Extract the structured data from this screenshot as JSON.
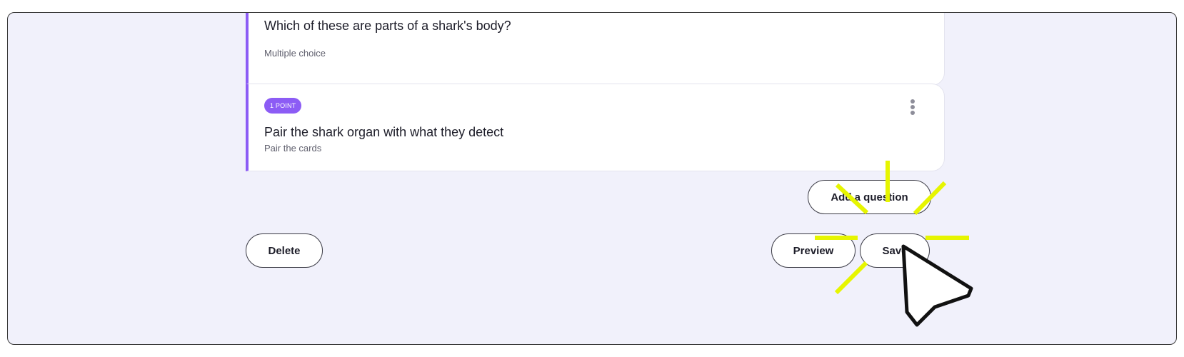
{
  "questions": [
    {
      "title": "Which of these are parts of a shark's body?",
      "type": "Multiple choice"
    },
    {
      "points_badge": "1 POINT",
      "title": "Pair the shark organ with what they detect",
      "type": "Pair the cards"
    }
  ],
  "actions": {
    "add_question_label": "Add a question",
    "delete_label": "Delete",
    "preview_label": "Preview",
    "save_label": "Save"
  },
  "colors": {
    "accent": "#8c5cf5",
    "background": "#f1f1fb",
    "highlight": "#e6f500"
  },
  "icons": {
    "card_menu": "kebab-menu-icon",
    "cursor": "mouse-pointer-icon",
    "click_highlight": "click-burst-icon"
  }
}
